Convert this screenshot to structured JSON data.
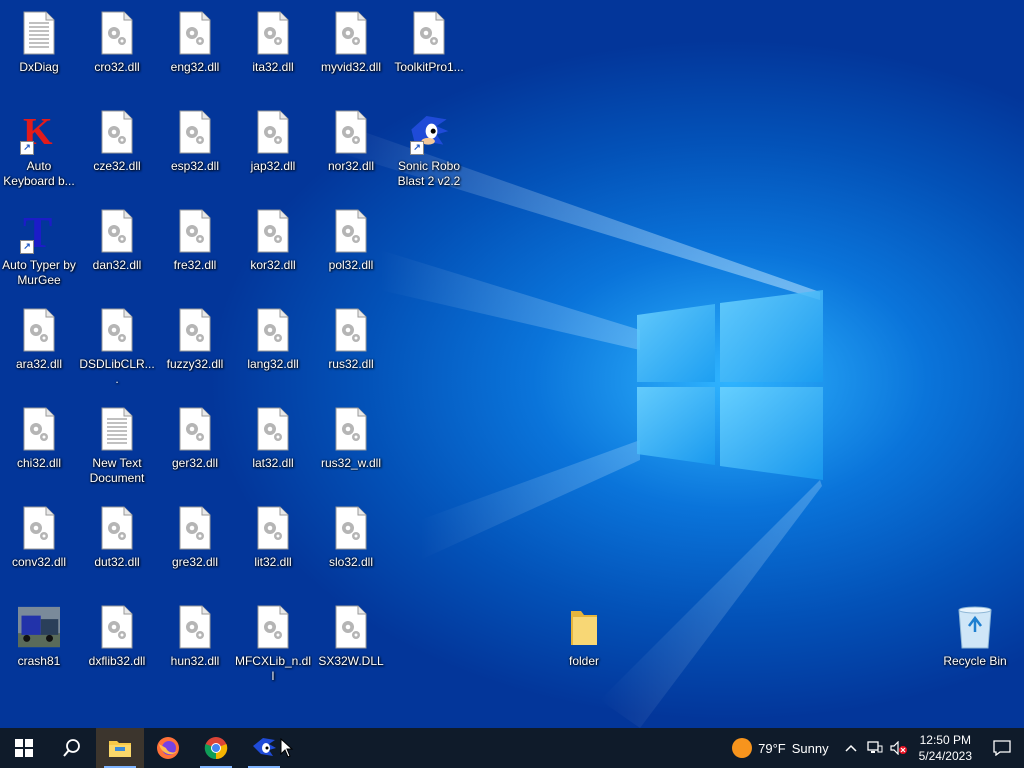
{
  "desktop": {
    "icons": [
      {
        "label": "DxDiag",
        "type": "doc"
      },
      {
        "label": "cro32.dll",
        "type": "dll"
      },
      {
        "label": "eng32.dll",
        "type": "dll"
      },
      {
        "label": "ita32.dll",
        "type": "dll"
      },
      {
        "label": "myvid32.dll",
        "type": "dll"
      },
      {
        "label": "ToolkitPro1...",
        "type": "dll"
      },
      {
        "label": "Auto Keyboard b...",
        "type": "k-app"
      },
      {
        "label": "cze32.dll",
        "type": "dll"
      },
      {
        "label": "esp32.dll",
        "type": "dll"
      },
      {
        "label": "jap32.dll",
        "type": "dll"
      },
      {
        "label": "nor32.dll",
        "type": "dll"
      },
      {
        "label": "Sonic Robo Blast 2 v2.2",
        "type": "sonic"
      },
      {
        "label": "Auto Typer by MurGee",
        "type": "t-app"
      },
      {
        "label": "dan32.dll",
        "type": "dll"
      },
      {
        "label": "fre32.dll",
        "type": "dll"
      },
      {
        "label": "kor32.dll",
        "type": "dll"
      },
      {
        "label": "pol32.dll",
        "type": "dll"
      },
      {
        "label": "ara32.dll",
        "type": "dll"
      },
      {
        "label": "DSDLibCLR....",
        "type": "dll"
      },
      {
        "label": "fuzzy32.dll",
        "type": "dll"
      },
      {
        "label": "lang32.dll",
        "type": "dll"
      },
      {
        "label": "rus32.dll",
        "type": "dll"
      },
      {
        "label": "chi32.dll",
        "type": "dll"
      },
      {
        "label": "New Text Document",
        "type": "doc"
      },
      {
        "label": "ger32.dll",
        "type": "dll"
      },
      {
        "label": "lat32.dll",
        "type": "dll"
      },
      {
        "label": "rus32_w.dll",
        "type": "dll"
      },
      {
        "label": "conv32.dll",
        "type": "dll"
      },
      {
        "label": "dut32.dll",
        "type": "dll"
      },
      {
        "label": "gre32.dll",
        "type": "dll"
      },
      {
        "label": "lit32.dll",
        "type": "dll"
      },
      {
        "label": "slo32.dll",
        "type": "dll"
      },
      {
        "label": "crash81",
        "type": "truck"
      },
      {
        "label": "dxflib32.dll",
        "type": "dll"
      },
      {
        "label": "hun32.dll",
        "type": "dll"
      },
      {
        "label": "MFCXLib_n.dll",
        "type": "dll"
      },
      {
        "label": "SX32W.DLL",
        "type": "dll"
      },
      {
        "label": "folder",
        "type": "folder"
      },
      {
        "label": "Recycle Bin",
        "type": "recycle"
      }
    ]
  },
  "taskbar": {
    "pinned": [
      {
        "name": "start",
        "icon": "windows-logo-icon"
      },
      {
        "name": "search",
        "icon": "search-icon"
      },
      {
        "name": "file-explorer",
        "icon": "folder-icon"
      },
      {
        "name": "firefox",
        "icon": "firefox-icon"
      },
      {
        "name": "chrome",
        "icon": "chrome-icon"
      },
      {
        "name": "sonic-robo-blast",
        "icon": "sonic-icon"
      }
    ],
    "weather": {
      "temp": "79°F",
      "condition": "Sunny"
    },
    "clock": {
      "time": "12:50 PM",
      "date": "5/24/2023"
    }
  },
  "colors": {
    "accent": "#0a74da",
    "taskbar": "#0f1b2a",
    "sun": "#f7941d"
  }
}
